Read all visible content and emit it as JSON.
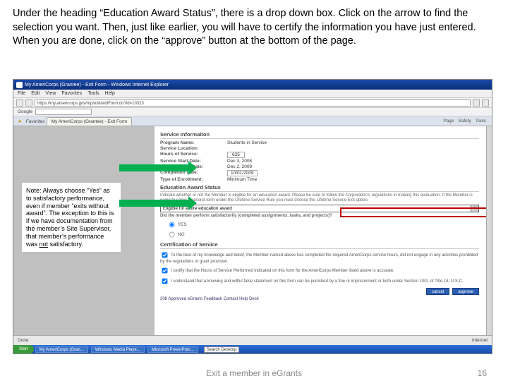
{
  "instruction": "Under the heading “Education Award Status”, there is a drop down box.  Click on the arrow to find the selection you want.  Then, just like earlier, you will have to certify the information you have just entered.  When you are done, click on the “approve” button at the bottom of the page.",
  "note": {
    "prefix": "Note:  Always choose “Yes” as to satisfactory performance, even if member “exits without award”.  The exception to this is if we have documentation from the member’s Site Supervisor, that member’s performance was ",
    "underlined": "not",
    "suffix": " satisfactory."
  },
  "browser": {
    "title": "My AmeriCorps (Grantee) - Exit Form - Windows Internet Explorer",
    "menubar": [
      "File",
      "Edit",
      "View",
      "Favorites",
      "Tools",
      "Help"
    ],
    "address": "https://my.americorps.gov/mp/exit/exitForm.do?id=10323",
    "google_label": "Google",
    "fav_label": "Favorites",
    "tab": "My AmeriCorps (Grantee) - Exit Form",
    "tabright": [
      "Page",
      "Safety",
      "Tools"
    ]
  },
  "form": {
    "section_service": "Service Information",
    "rows": {
      "program_name_lbl": "Program Name:",
      "program_name_val": "Students in Service",
      "service_loc_lbl": "Service Location:",
      "service_loc_val": "",
      "hours_lbl": "Hours of Service:",
      "hours_val": "635",
      "start_lbl": "Service Start Date:",
      "start_val": "Dec 3, 2008",
      "expend_lbl": "Expected End Date:",
      "expend_val": "Dec 2, 2009",
      "comp_lbl": "Completion Date:",
      "comp_val": "10/01/2009",
      "enroll_lbl": "Type of Enrollment:",
      "enroll_val": "Minimum Time"
    },
    "section_award": "Education Award Status",
    "award_text": "Indicate whether or not the Member is eligible for an education award. Please be sure to follow the Corporation's regulations in making this evaluation. If the Member is going to serve a second term under the Lifetime Service Rule you must choose the Lifetime Service Exit option.",
    "dropdown_value": "Eligible for entire education award",
    "perf_q": "Did the member perform satisfactorily (completed assignments, tasks, and projects)?",
    "yes": "YES",
    "no": "NO",
    "section_cert": "Certification of Service",
    "cert1": "To the best of my knowledge and belief, the Member named above has completed the required AmeriCorps service hours, did not engage in any activities prohibited by the regulations or grant provision.",
    "cert2": "I certify that the Hours of Service Performed indicated on this form for the AmeriCorps Member listed above is accurate.",
    "cert3": "I understand that a knowing and willful false statement on this form can be punished by a fine or imprisonment or both under Section 1001 of Title 18, U.S.C.",
    "btn_cancel": "cancel",
    "btn_approve": "approve",
    "bottom_links": "208 Approved   eGrants Feedback   Contact Help Desk"
  },
  "statusbar": {
    "done": "Done",
    "internet": "Internet"
  },
  "taskbar": {
    "start": "Start",
    "items": [
      "My AmeriCorps (Gran...",
      "Windows Media Playe...",
      "Microsoft PowerPoin..."
    ],
    "search": "Search Desktop"
  },
  "footer": {
    "center": "Exit a member in eGrants",
    "page": "16"
  }
}
